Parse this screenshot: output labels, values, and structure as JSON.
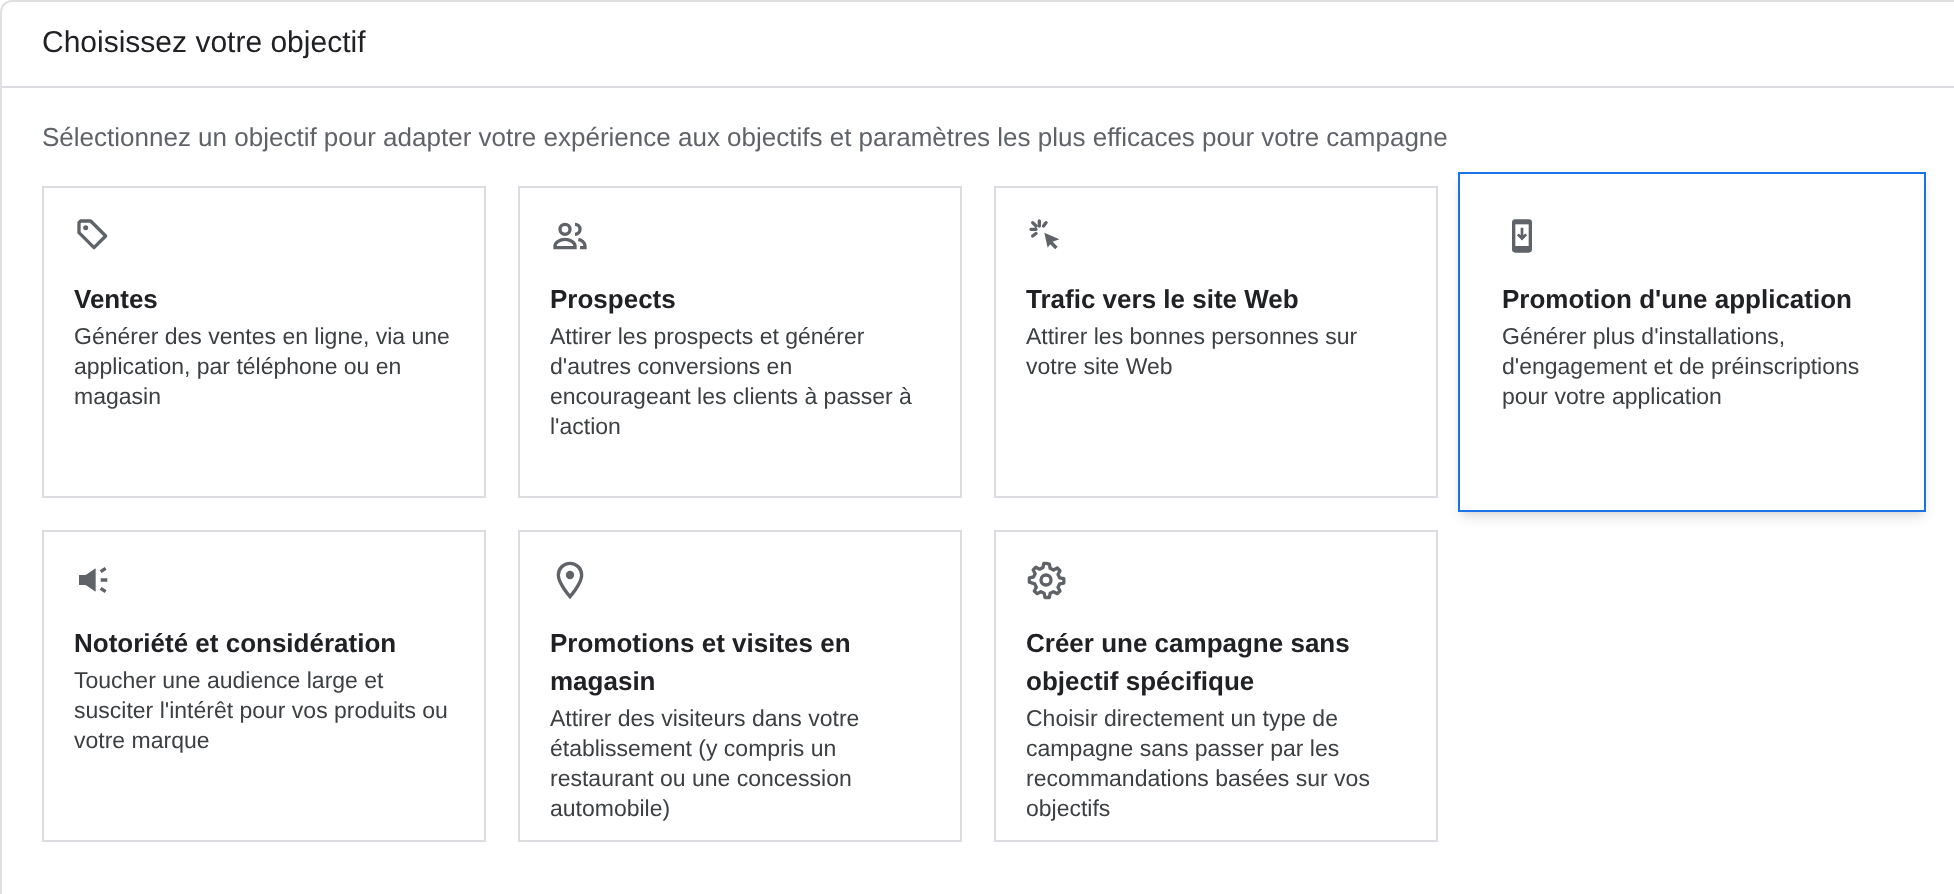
{
  "header": {
    "title": "Choisissez votre objectif"
  },
  "intro": "Sélectionnez un objectif pour adapter votre expérience aux objectifs et paramètres les plus efficaces pour votre campagne",
  "objectives": [
    {
      "kind": "tag",
      "title": "Ventes",
      "description": "Générer des ventes en ligne, via une application, par téléphone ou en magasin",
      "selected": false
    },
    {
      "kind": "people",
      "title": "Prospects",
      "description": "Attirer les prospects et générer d'autres conversions en encourageant les clients à passer à l'action",
      "selected": false
    },
    {
      "kind": "click",
      "title": "Trafic vers le site Web",
      "description": "Attirer les bonnes personnes sur votre site Web",
      "selected": false
    },
    {
      "kind": "phone",
      "title": "Promotion d'une application",
      "description": "Générer plus d'installations, d'engagement et de préinscriptions pour votre application",
      "selected": true
    },
    {
      "kind": "megaphone",
      "title": "Notoriété et considération",
      "description": "Toucher une audience large et susciter l'intérêt pour vos produits ou votre marque",
      "selected": false
    },
    {
      "kind": "pin",
      "title": "Promotions et visites en magasin",
      "description": "Attirer des visiteurs dans votre établissement (y compris un restaurant ou une concession automobile)",
      "selected": false
    },
    {
      "kind": "gear",
      "title": "Créer une campagne sans objectif spécifique",
      "description": "Choisir directement un type de campagne sans passer par les recommandations basées sur vos objectifs",
      "selected": false
    }
  ]
}
